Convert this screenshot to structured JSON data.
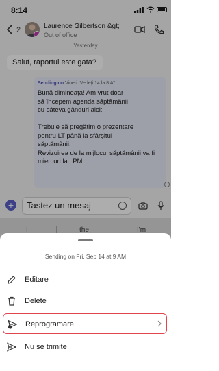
{
  "status_bar": {
    "time": "8:14"
  },
  "header": {
    "unread_count": "2",
    "contact_name": "Laurence Gilbertson &gt;",
    "contact_status": "Out of office"
  },
  "chat": {
    "day_label": "Yesterday",
    "incoming_message": "Salut, raportul este gata?",
    "scheduled_message": {
      "meta_prefix": "Sending on",
      "meta_when": "Vineri. Vedeți 14 la 8 A\"",
      "body": "Bună dimineața! Am vrut doar\nsă începem agenda săptămânii\ncu câteva gânduri aici:\n\nTrebuie să pregătim o prezentare\npentru LT până la sfârșitul\nsăptămânii.\nRevizuirea de la mijlocul săptămânii va fi\nmiercuri la l PM."
    }
  },
  "compose": {
    "placeholder": "Tastez un mesaj"
  },
  "keyboard": {
    "suggestions": [
      "I",
      "the",
      "I'm"
    ]
  },
  "sheet": {
    "title": "Sending on Fri, Sep 14 at 9 AM",
    "items": [
      {
        "label": "Editare",
        "icon": "pencil-icon"
      },
      {
        "label": "Delete",
        "icon": "trash-icon"
      },
      {
        "label": "Reprogramare",
        "icon": "send-clock-icon"
      },
      {
        "label": "Nu se trimite",
        "icon": "send-icon"
      }
    ]
  },
  "colors": {
    "accent": "#5b5fc7",
    "highlight": "#e0454e",
    "presence": "#c239b3"
  }
}
